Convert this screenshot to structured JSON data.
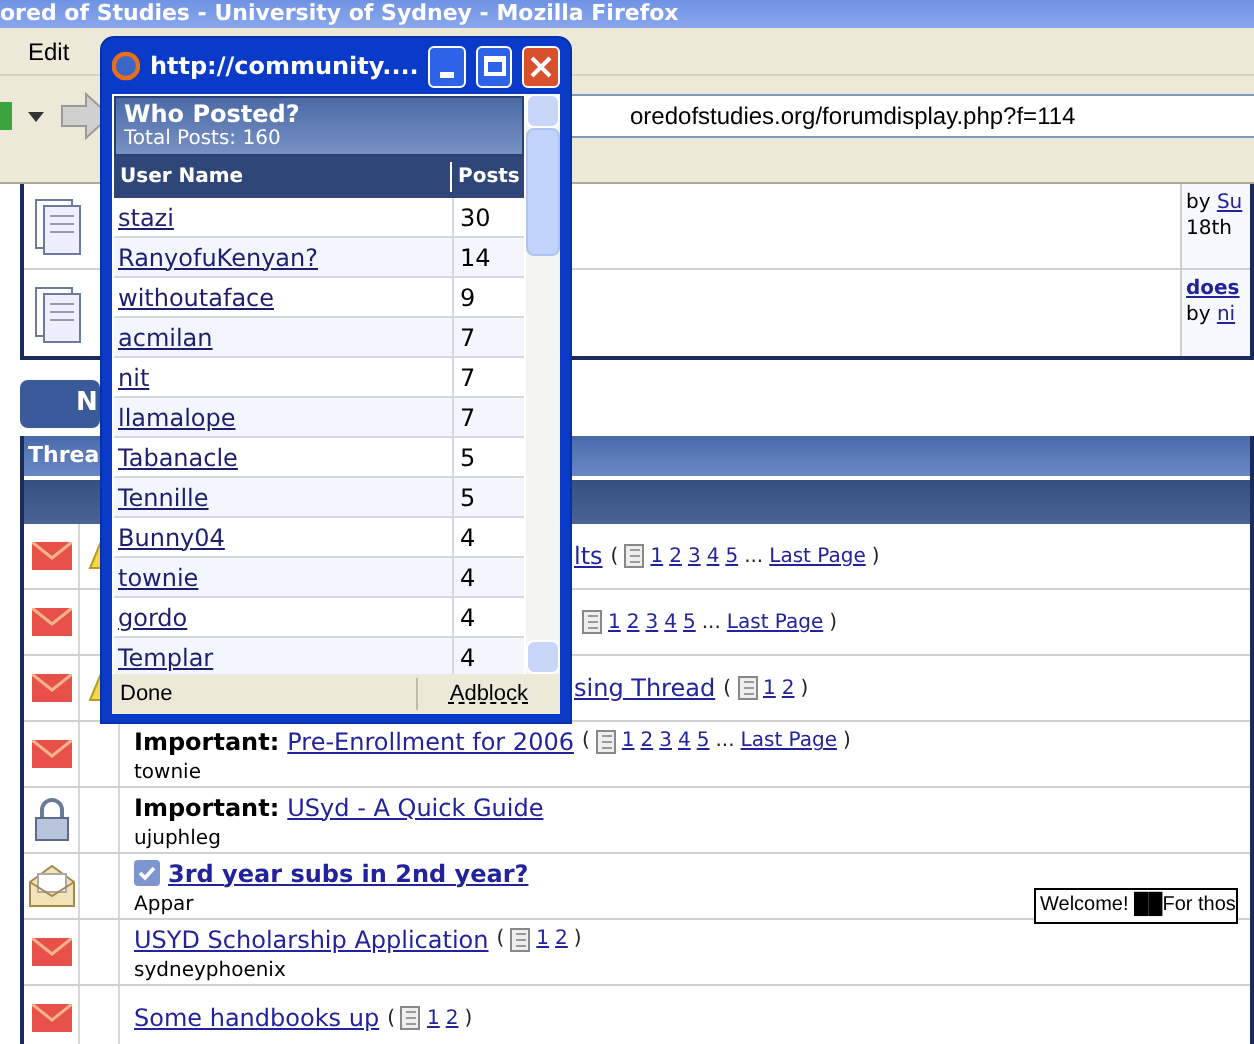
{
  "window": {
    "title": "ored of Studies - University of Sydney - Mozilla Firefox"
  },
  "menu": [
    "Edit"
  ],
  "address_bar": {
    "value": "oredofstudies.org/forumdisplay.php?f=114"
  },
  "forums": [
    {
      "by": "by",
      "user": "Su",
      "date": "18th"
    },
    {
      "title": "does",
      "by": "by",
      "user": "ni"
    }
  ],
  "new_thread_button": {
    "label": "N"
  },
  "threads_header": {
    "title": "Threa"
  },
  "threads": [
    {
      "kind": "covered",
      "locked": false,
      "read": false,
      "attention": true,
      "title": "lts",
      "pages": {
        "open": "(",
        "numbers": [
          "1",
          "2",
          "3",
          "4",
          "5"
        ],
        "ellipsis": "...",
        "last": "Last Page",
        "close": ")"
      }
    },
    {
      "kind": "covered",
      "locked": false,
      "read": false,
      "attention": false,
      "pages": {
        "numbers": [
          "1",
          "2",
          "3",
          "4",
          "5"
        ],
        "ellipsis": "...",
        "last": "Last Page",
        "close": ")"
      }
    },
    {
      "kind": "covered",
      "locked": false,
      "read": false,
      "attention": true,
      "title": "sing Thread",
      "pages": {
        "open": "(",
        "numbers": [
          "1",
          "2"
        ],
        "close": ")"
      }
    },
    {
      "kind": "full",
      "locked": false,
      "read": false,
      "attention": false,
      "prefix": "Important:",
      "title": "Pre-Enrollment for 2006",
      "author": "townie",
      "pages": {
        "open": "(",
        "numbers": [
          "1",
          "2",
          "3",
          "4",
          "5"
        ],
        "ellipsis": "...",
        "last": "Last Page",
        "close": ")"
      }
    },
    {
      "kind": "full",
      "locked": true,
      "read": false,
      "attention": false,
      "prefix": "Important:",
      "title": "USyd - A Quick Guide",
      "author": "ujuphleg"
    },
    {
      "kind": "full",
      "locked": false,
      "read": true,
      "attention": false,
      "ticked": true,
      "bold": true,
      "title": "3rd year subs in 2nd year?",
      "author": "Appar"
    },
    {
      "kind": "full",
      "locked": false,
      "read": false,
      "attention": false,
      "title": "USYD Scholarship Application",
      "author": "sydneyphoenix",
      "pages": {
        "open": "(",
        "numbers": [
          "1",
          "2"
        ],
        "close": ")"
      }
    },
    {
      "kind": "full",
      "locked": false,
      "read": false,
      "attention": false,
      "title": "Some handbooks up",
      "pages": {
        "open": "(",
        "numbers": [
          "1",
          "2"
        ],
        "close": ")"
      }
    }
  ],
  "tooltip": {
    "text": "Welcome! ██For thos"
  },
  "popup": {
    "title": "http://community....",
    "heading": "Who Posted?",
    "total": "Total Posts: 160",
    "columns": [
      "User Name",
      "Posts"
    ],
    "rows": [
      {
        "user": "stazi",
        "posts": "30"
      },
      {
        "user": "RanyofuKenyan?",
        "posts": "14"
      },
      {
        "user": "withoutaface",
        "posts": "9"
      },
      {
        "user": "acmilan",
        "posts": "7"
      },
      {
        "user": "nit",
        "posts": "7"
      },
      {
        "user": "llamalope",
        "posts": "7"
      },
      {
        "user": "Tabanacle",
        "posts": "5"
      },
      {
        "user": "Tennille",
        "posts": "5"
      },
      {
        "user": "Bunny04",
        "posts": "4"
      },
      {
        "user": "townie",
        "posts": "4"
      },
      {
        "user": "gordo",
        "posts": "4"
      },
      {
        "user": "Templar",
        "posts": "4"
      }
    ],
    "status": "Done",
    "addon": "Adblock"
  }
}
